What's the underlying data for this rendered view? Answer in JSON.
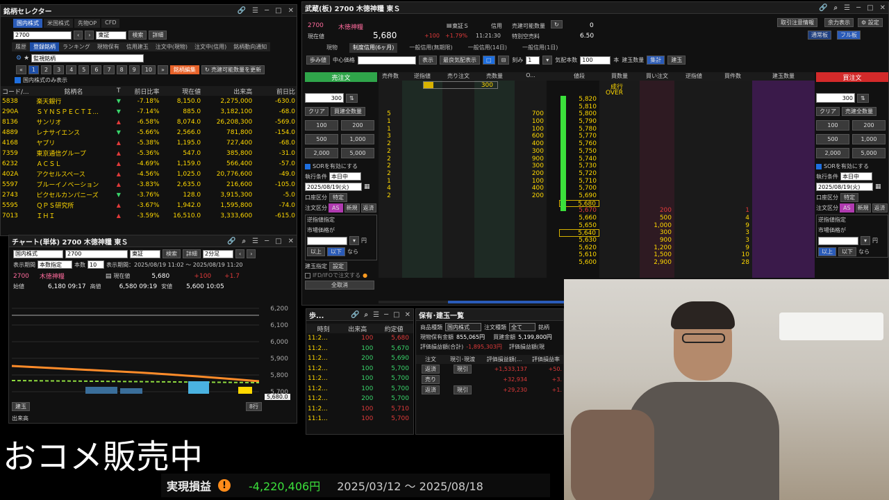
{
  "selector": {
    "title": "銘柄セレクター",
    "tabs": [
      "国内株式",
      "米国株式",
      "先物OP",
      "CFD"
    ],
    "code": "2700",
    "market": "東証",
    "search_btn": "検索",
    "detail_btn": "詳細",
    "subtabs": [
      "履歴",
      "登録銘柄",
      "ランキング",
      "現物保有",
      "信用建玉",
      "注文中(現物)",
      "注文中(信用)",
      "銘柄動向通知"
    ],
    "list_name": "監視銘柄",
    "pages": [
      "1",
      "2",
      "3",
      "4",
      "5",
      "6",
      "7",
      "8",
      "9",
      "10"
    ],
    "edit_btn": "銘柄編集",
    "update_btn": "売建可能数量を更新",
    "domestic_only": "国内株式のみ表示",
    "headers": [
      "コード/...",
      "銘柄名",
      "T",
      "前日比率",
      "現在値",
      "出来高",
      "前日比"
    ],
    "rows": [
      {
        "code": "5838",
        "name": "楽天銀行",
        "dir": "down",
        "pct": "-7.18%",
        "price": "8,150.0",
        "vol": "2,275,000",
        "chg": "-630.0"
      },
      {
        "code": "290A",
        "name": "ＳＹＮＳＰＥＣＴＩ...",
        "dir": "down",
        "pct": "-7.14%",
        "price": "885.0",
        "vol": "3,182,100",
        "chg": "-68.0"
      },
      {
        "code": "8136",
        "name": "サンリオ",
        "dir": "up",
        "pct": "-6.58%",
        "price": "8,074.0",
        "vol": "26,208,300",
        "chg": "-569.0"
      },
      {
        "code": "4889",
        "name": "レナサイエンス",
        "dir": "down",
        "pct": "-5.66%",
        "price": "2,566.0",
        "vol": "781,800",
        "chg": "-154.0"
      },
      {
        "code": "4168",
        "name": "ヤプリ",
        "dir": "up",
        "pct": "-5.38%",
        "price": "1,195.0",
        "vol": "727,400",
        "chg": "-68.0"
      },
      {
        "code": "7359",
        "name": "東京通信グループ",
        "dir": "up",
        "pct": "-5.36%",
        "price": "547.0",
        "vol": "385,800",
        "chg": "-31.0"
      },
      {
        "code": "6232",
        "name": "ＡＣＳＬ",
        "dir": "up",
        "pct": "-4.69%",
        "price": "1,159.0",
        "vol": "566,400",
        "chg": "-57.0"
      },
      {
        "code": "402A",
        "name": "アクセルスペース",
        "dir": "up",
        "pct": "-4.56%",
        "price": "1,025.0",
        "vol": "20,776,600",
        "chg": "-49.0"
      },
      {
        "code": "5597",
        "name": "ブルーイノベーション",
        "dir": "up",
        "pct": "-3.83%",
        "price": "2,635.0",
        "vol": "216,600",
        "chg": "-105.0"
      },
      {
        "code": "2743",
        "name": "ピクセルカンパニーズ",
        "dir": "down",
        "pct": "-3.76%",
        "price": "128.0",
        "vol": "3,915,300",
        "chg": "-5.0"
      },
      {
        "code": "5595",
        "name": "ＱＰＳ研究所",
        "dir": "up",
        "pct": "-3.67%",
        "price": "1,942.0",
        "vol": "1,595,800",
        "chg": "-74.0"
      },
      {
        "code": "7013",
        "name": "ＩＨＩ",
        "dir": "up",
        "pct": "-3.59%",
        "price": "16,510.0",
        "vol": "3,333,600",
        "chg": "-615.0"
      }
    ]
  },
  "chart": {
    "title": "チャート(単体) 2700 木徳神糧 東Ｓ",
    "market_type": "国内株式",
    "code": "2700",
    "exchange": "東証",
    "search": "検索",
    "detail": "詳細",
    "interval": "2分足",
    "period_label": "表示期間",
    "period_value": "本数指定",
    "count_label": "本数",
    "count": "10",
    "range_label": "表示期間：2025/08/19 11:02 ～ 2025/08/19 11:20",
    "code_disp": "2700",
    "name_disp": "木徳神糧",
    "price_label": "現在値",
    "price": "5,680",
    "change": "+100",
    "change_pct": "+1.7",
    "open_label": "始値",
    "open": "6,180 09:17",
    "high_label": "高値",
    "high": "6,580 09:19",
    "low_label": "安値",
    "low": "5,600 10:05",
    "yticks": [
      "6,200",
      "6,100",
      "6,000",
      "5,900",
      "5,800",
      "5,700",
      "5,600"
    ],
    "price_tag": "5,680.0",
    "foot_left": "建玉",
    "foot_right": "8行",
    "volume_label": "出来高"
  },
  "board": {
    "title": "武蔵(板) 2700 木徳神糧 東Ｓ",
    "code": "2700",
    "name": "木徳神糧",
    "price_label": "現在値",
    "price": "5,680",
    "change": "+100",
    "change_pct": "+1.79%",
    "time": "11:21:30",
    "exch": "東証Ｓ",
    "credit": "信用",
    "sellable_label": "売建可能数量",
    "sellable": "0",
    "special_label": "特別空売料",
    "special": "6.50",
    "top_btns": [
      "取引注意情報",
      "余力表示",
      "設定"
    ],
    "sub_btns": [
      "通常板",
      "フル板"
    ],
    "acct_tabs": [
      "現物",
      "制度信用(6ヶ月)",
      "一般信用(無期限)",
      "一般信用(14日)",
      "一般信用(1日)"
    ],
    "tool": {
      "step": "歩み値",
      "center": "中心価格",
      "show": "表示",
      "best": "最良気配表示",
      "tick_label": "刻み",
      "tick": "1",
      "qty_label": "気配本数",
      "qty": "100",
      "unit": "本",
      "pos_qty": "建玉数量",
      "total": "集計",
      "pos": "建玉"
    },
    "headers": [
      "売件数",
      "逆指値",
      "売り注文",
      "売数量",
      "O...",
      "値段",
      "買数量",
      "買い注文",
      "逆指値",
      "買件数",
      "建玉数量"
    ],
    "market_label": "成行",
    "over_label": "OVER",
    "asks": [
      {
        "p": "5,820",
        "q": "",
        "c": ""
      },
      {
        "p": "5,810",
        "q": "",
        "c": ""
      },
      {
        "p": "5,800",
        "q": "700",
        "c": "5"
      },
      {
        "p": "5,790",
        "q": "100",
        "c": "1"
      },
      {
        "p": "5,780",
        "q": "100",
        "c": "1"
      },
      {
        "p": "5,770",
        "q": "600",
        "c": "3"
      },
      {
        "p": "5,760",
        "q": "400",
        "c": "2"
      },
      {
        "p": "5,750",
        "q": "300",
        "c": "2"
      },
      {
        "p": "5,740",
        "q": "900",
        "c": "2"
      },
      {
        "p": "5,730",
        "q": "300",
        "c": "2"
      },
      {
        "p": "5,720",
        "q": "200",
        "c": "2"
      },
      {
        "p": "5,710",
        "q": "100",
        "c": "1"
      },
      {
        "p": "5,700",
        "q": "400",
        "c": "4"
      },
      {
        "p": "5,690",
        "q": "200",
        "c": "2"
      }
    ],
    "cur_price": "5,680",
    "bid_hi": {
      "p": "5,670",
      "q": "200",
      "c": "1"
    },
    "bids": [
      {
        "p": "5,660",
        "q": "500",
        "c": "4"
      },
      {
        "p": "5,650",
        "q": "1,000",
        "c": "9"
      },
      {
        "p": "5,640",
        "q": "300",
        "c": "3"
      },
      {
        "p": "5,630",
        "q": "900",
        "c": "3"
      },
      {
        "p": "5,620",
        "q": "1,200",
        "c": "9"
      },
      {
        "p": "5,610",
        "q": "1,500",
        "c": "10"
      },
      {
        "p": "5,600",
        "q": "2,900",
        "c": "28"
      }
    ],
    "ask_order": "300",
    "sell": {
      "title": "売注文",
      "qty": "300",
      "clear": "クリア",
      "all": "買建全数量",
      "amts": [
        "100",
        "200",
        "500",
        "1,000",
        "2,000",
        "5,000"
      ],
      "sor": "SORを有効にする",
      "cond_label": "執行条件",
      "cond": "本日中",
      "date": "2025/08/19(火)",
      "acct_label": "口座区分",
      "acct": "特定",
      "ord_label": "注文区分",
      "as": "AS",
      "new": "新規",
      "close": "返済",
      "stop_label": "逆指値指定",
      "mkt_label": "市場価格が",
      "yen": "円",
      "above": "以上",
      "below": "以下",
      "nara": "なら",
      "pos_label": "建玉指定",
      "setting": "設定",
      "ifd": "IFD/IFOで注文する",
      "all_btn": "全取消"
    },
    "buy": {
      "title": "買注文",
      "qty": "300",
      "clear": "クリア",
      "all": "売建全数量",
      "amts": [
        "100",
        "200",
        "500",
        "1,000",
        "2,000",
        "5,000"
      ],
      "sor": "SORを有効にする",
      "cond_label": "執行条件",
      "cond": "本日中",
      "date": "2025/08/19(火)",
      "acct_label": "口座区分",
      "acct": "特定",
      "ord_label": "注文区分",
      "as": "AS",
      "new": "新規",
      "close": "返済",
      "stop_label": "逆指値指定",
      "mkt_label": "市場価格が",
      "yen": "円",
      "above": "以上",
      "below": "以下",
      "nara": "なら"
    }
  },
  "ticks": {
    "title": "歩...",
    "headers": [
      "時刻",
      "出来高",
      "約定値"
    ],
    "rows": [
      {
        "t": "11:2...",
        "v": "100",
        "p": "5,680",
        "c": "red"
      },
      {
        "t": "11:2...",
        "v": "100",
        "p": "5,670",
        "c": "grn"
      },
      {
        "t": "11:2...",
        "v": "200",
        "p": "5,690",
        "c": "grn"
      },
      {
        "t": "11:2...",
        "v": "100",
        "p": "5,700",
        "c": "grn"
      },
      {
        "t": "11:2...",
        "v": "100",
        "p": "5,700",
        "c": "grn"
      },
      {
        "t": "11:2...",
        "v": "100",
        "p": "5,700",
        "c": "grn"
      },
      {
        "t": "11:2...",
        "v": "200",
        "p": "5,700",
        "c": "grn"
      },
      {
        "t": "11:2...",
        "v": "100",
        "p": "5,710",
        "c": "red"
      },
      {
        "t": "11:1...",
        "v": "100",
        "p": "5,700",
        "c": "red"
      }
    ]
  },
  "holdings": {
    "title": "保有･建玉一覧",
    "type_label": "商品種類",
    "type": "国内株式",
    "ord_label": "注文種類",
    "ord": "全て",
    "brand": "銘柄",
    "cash_label": "現物保有金額",
    "cash": "855,065円",
    "buy_label": "買建金額",
    "buy": "5,199,800円",
    "eval_label": "評価損益額(合計)",
    "eval": "-1,895,303円",
    "eval2_label": "評価損益額(現",
    "headers": [
      "注文",
      "現引･現渡",
      "評価損益額(...",
      "評価損益率"
    ],
    "rows": [
      {
        "a": "返済",
        "b": "現引",
        "c": "+1,533,137",
        "d": "+50."
      },
      {
        "a": "売り",
        "b": "",
        "c": "+32,934",
        "d": "+3."
      },
      {
        "a": "返済",
        "b": "現引",
        "c": "+29,230",
        "d": "+1."
      }
    ]
  },
  "overlay": {
    "rice": "おコメ販売中",
    "realized_label": "実現損益",
    "realized": "-4,220,406円",
    "period": "2025/03/12 ～ 2025/08/18"
  }
}
